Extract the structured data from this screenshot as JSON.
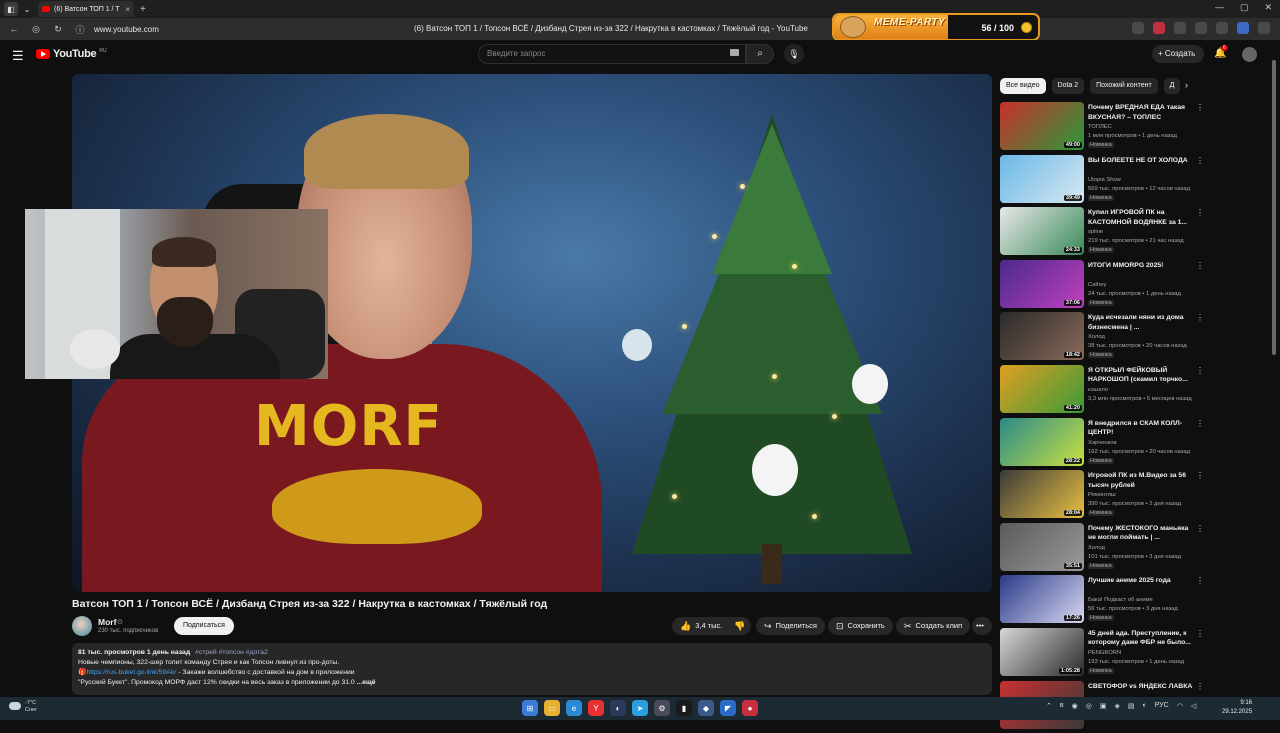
{
  "browser": {
    "tab_title": "(6) Ватсон ТОП 1 / Т",
    "tab_close": "×",
    "new_tab": "+",
    "url": "www.youtube.com",
    "page_title": "(6) Ватсон ТОП 1 / Топсон ВСЁ / Дизбанд Стрея из-за 322 / Накрутка в кастомках / Тяжёлый год - YouTube",
    "window_controls": [
      "—",
      "▢",
      "✕"
    ]
  },
  "meme_party": {
    "title": "MEME-PARTY",
    "count": "56 / 100",
    "progress": 0.56
  },
  "header": {
    "logo_text": "YouTube",
    "logo_region": "RU",
    "search_placeholder": "Введите запрос",
    "create_label": "Создать",
    "notification_count": "6"
  },
  "video": {
    "shirt_text": "MORF",
    "title": "Ватсон ТОП 1 / Топсон ВСЁ / Дизбанд Стрея из-за 322 / Накрутка в кастомках / Тяжёлый год"
  },
  "channel": {
    "name": "Morf",
    "verified": "⊙",
    "subscribers": "230 тыс. подписчиков",
    "subscribe_label": "Подписаться"
  },
  "actions": {
    "like_count": "3,4 тыс.",
    "share_label": "Поделиться",
    "save_label": "Сохранить",
    "clip_label": "Создать клип",
    "more_label": "•••"
  },
  "description": {
    "meta": "81 тыс. просмотров  1 день назад",
    "tags": "#стрей #топсон #дота2",
    "line1": "Новые чемпионы, 322-шер топит команду Стрея и как Топсон ливнул из про-доты.",
    "link": "https://rus-buket.go.link/59Akr",
    "line2_rest": " - Закажи волшебство с доставкой на дом в приложении",
    "line3": "\"Русский Букет\". Промокод МОРФ даст 12% скидки на весь заказ в приложении до 31.0",
    "more": "...ещё"
  },
  "chips": [
    "Все видео",
    "Dota 2",
    "Похожий контент",
    "Д"
  ],
  "related": [
    {
      "title": "Почему ВРЕДНАЯ ЕДА такая ВКУСНАЯ? – ТОПЛЕС",
      "channel": "ТОПЛЕС",
      "meta": "1 млн просмотров • 1 день назад",
      "badge": "Новинка",
      "duration": "49:00",
      "color1": "#c8302a",
      "color2": "#2a9a3a"
    },
    {
      "title": "ВЫ БОЛЕЕТЕ НЕ ОТ ХОЛОДА",
      "channel": "Utopia Show",
      "meta": "569 тыс. просмотров • 12 часов назад",
      "badge": "Новинка",
      "duration": "39:49",
      "color1": "#6ab8e8",
      "color2": "#d8e8f0"
    },
    {
      "title": "Купил ИГРОВОЙ ПК на КАСТОМНОЙ ВОДЯНКЕ за 1...",
      "channel": "spline",
      "meta": "219 тыс. просмотров • 21 час назад",
      "badge": "Новинка",
      "duration": "24:33",
      "color1": "#e8e8e8",
      "color2": "#3a8a5a"
    },
    {
      "title": "ИТОГИ MMORPG 2025!",
      "channel": "Cathey",
      "meta": "24 тыс. просмотров • 1 день назад",
      "badge": "Новинка",
      "duration": "37:06",
      "color1": "#4a2a8a",
      "color2": "#c040c0"
    },
    {
      "title": "Куда исчезали няни из дома бизнесмена | ...",
      "channel": "Холод",
      "meta": "38 тыс. просмотров • 20 часов назад",
      "badge": "Новинка",
      "duration": "18:42",
      "color1": "#2a2a2a",
      "color2": "#8a6a5a"
    },
    {
      "title": "Я ОТКРЫЛ ФЕЙКОВЫЙ НАРКОШОП (скамил торчко...",
      "channel": "кэшало",
      "meta": "3,3 млн просмотров • 5 месяцев назад",
      "badge": "",
      "duration": "41:20",
      "color1": "#e0a020",
      "color2": "#3a9a3a"
    },
    {
      "title": "Я внедрился в СКАМ КОЛЛ-ЦЕНТР!",
      "channel": "Харченков",
      "meta": "162 тыс. просмотров • 20 часов назад",
      "badge": "Новинка",
      "duration": "28:22",
      "color1": "#2a8a8a",
      "color2": "#c8e040"
    },
    {
      "title": "Игровой ПК из М.Видео за 56 тысяч рублей",
      "channel": "Ремонтяш",
      "meta": "390 тыс. просмотров • 2 дня назад",
      "badge": "Новинка",
      "duration": "28:04",
      "color1": "#3a3a3a",
      "color2": "#e8c040"
    },
    {
      "title": "Почему ЖЕСТОКОГО маньяка не могли поймать | ...",
      "channel": "Холод",
      "meta": "101 тыс. просмотров • 3 дня назад",
      "badge": "Новинка",
      "duration": "35:51",
      "color1": "#5a5a5a",
      "color2": "#9a9a9a"
    },
    {
      "title": "Лучшие аниме 2025 года",
      "channel": "Бака! Подкаст об аниме",
      "meta": "56 тыс. просмотров • 3 дня назад",
      "badge": "Новинка",
      "duration": "17:26",
      "color1": "#2a3a8a",
      "color2": "#d8d8f0"
    },
    {
      "title": "45 дней ада. Преступление, к которому даже ФБР не было...",
      "channel": "PENGBORN",
      "meta": "193 тыс. просмотров • 1 день назад",
      "badge": "Новинка",
      "duration": "1:05:28",
      "color1": "#d8d8d8",
      "color2": "#2a2a2a"
    },
    {
      "title": "СВЕТОФОР vs ЯНДЕКС ЛАВКА",
      "channel": "",
      "meta": "",
      "badge": "",
      "duration": "",
      "color1": "#c83030",
      "color2": "#3a3a3a"
    }
  ],
  "taskbar": {
    "temp": "-7°C",
    "weather": "Снег",
    "lang": "РУС",
    "time": "9:16",
    "date": "29.12.2025"
  }
}
